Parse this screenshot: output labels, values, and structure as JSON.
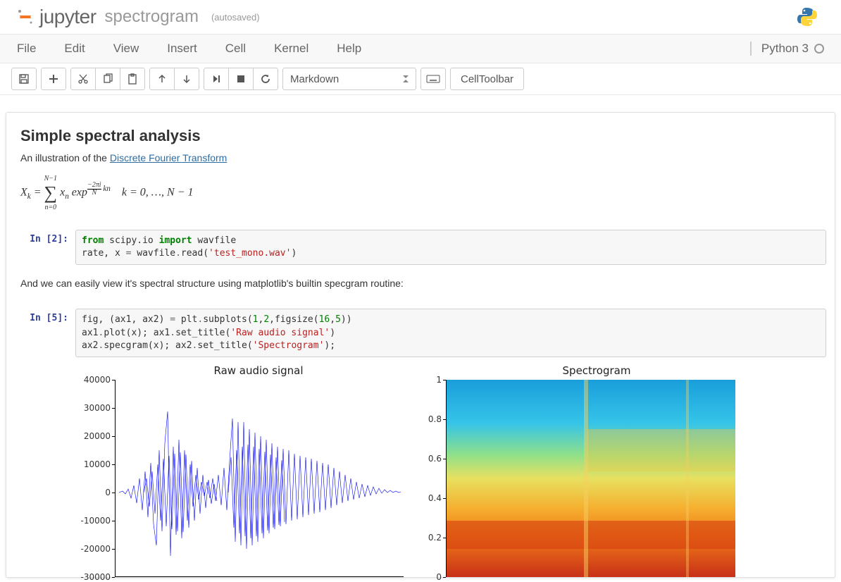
{
  "header": {
    "logo_text": "jupyter",
    "notebook_name": "spectrogram",
    "autosave": "(autosaved)"
  },
  "menu": [
    "File",
    "Edit",
    "View",
    "Insert",
    "Cell",
    "Kernel",
    "Help"
  ],
  "kernel_name": "Python 3",
  "toolbar": {
    "cell_type": "Markdown",
    "celltoolbar": "CellToolbar"
  },
  "md1": {
    "title": "Simple spectral analysis",
    "intro_pre": "An illustration of the ",
    "intro_link": "Discrete Fourier Transform",
    "formula_range": "k = 0, …, N − 1"
  },
  "code1": {
    "prompt": "In [2]:",
    "line1_a": "from",
    "line1_b": " scipy.io ",
    "line1_c": "import",
    "line1_d": " wavfile",
    "line2_a": "rate, x ",
    "line2_b": "=",
    "line2_c": " wavfile",
    "line2_d": ".",
    "line2_e": "read(",
    "line2_f": "'test_mono.wav'",
    "line2_g": ")"
  },
  "md2": {
    "text": "And we can easily view it's spectral structure using matplotlib's builtin specgram routine:"
  },
  "code2": {
    "prompt": "In [5]:",
    "l1a": "fig, (ax1, ax2) ",
    "l1b": "=",
    "l1c": " plt",
    "l1d": ".",
    "l1e": "subplots(",
    "l1f": "1",
    "l1g": ",",
    "l1h": "2",
    "l1i": ",figsize(",
    "l1j": "16",
    "l1k": ",",
    "l1l": "5",
    "l1m": "))",
    "l2a": "ax1",
    "l2b": ".",
    "l2c": "plot(x); ax1",
    "l2d": ".",
    "l2e": "set_title(",
    "l2f": "'Raw audio signal'",
    "l2g": ")",
    "l3a": "ax2",
    "l3b": ".",
    "l3c": "specgram(x); ax2",
    "l3d": ".",
    "l3e": "set_title(",
    "l3f": "'Spectrogram'",
    "l3g": ");"
  },
  "chart_data": [
    {
      "type": "line",
      "title": "Raw audio signal",
      "ylim": [
        -30000,
        40000
      ],
      "yticks": [
        -30000,
        -20000,
        -10000,
        0,
        10000,
        20000,
        30000,
        40000
      ],
      "note": "dense blue waveform oscillating roughly between -25000 and 35000"
    },
    {
      "type": "heatmap",
      "title": "Spectrogram",
      "ylim": [
        0.0,
        1.0
      ],
      "yticks": [
        0.0,
        0.2,
        0.4,
        0.6,
        0.8,
        1.0
      ],
      "note": "time-frequency colormap, blue/cyan at high freq, orange/red at low freq"
    }
  ]
}
